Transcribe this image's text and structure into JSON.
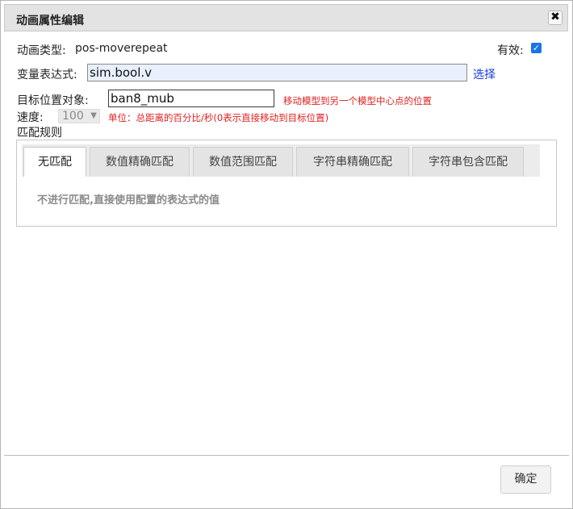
{
  "dialog": {
    "title": "动画属性编辑",
    "close_glyph": "✖"
  },
  "form": {
    "anim_type_label": "动画类型:",
    "anim_type_value": "pos-moverepeat",
    "valid_label": "有效:",
    "valid_checked": true,
    "expr_label": "变量表达式:",
    "expr_value": "sim.bool.v",
    "select_link": "选择",
    "target_label": "目标位置对象:",
    "target_value": "ban8_mub",
    "target_hint": "移动模型到另一个模型中心点的位置",
    "speed_label": "速度:",
    "speed_value": "100",
    "speed_hint": "单位：总距离的百分比/秒(0表示直接移动到目标位置)",
    "rules_label": "匹配规则"
  },
  "tabs": [
    {
      "label": "无匹配",
      "active": true
    },
    {
      "label": "数值精确匹配",
      "active": false
    },
    {
      "label": "数值范围匹配",
      "active": false
    },
    {
      "label": "字符串精确匹配",
      "active": false
    },
    {
      "label": "字符串包含匹配",
      "active": false
    }
  ],
  "rule_description": "不进行匹配,直接使用配置的表达式的值",
  "footer": {
    "confirm_label": "确定"
  },
  "colors": {
    "accent": "#1a73e8",
    "hint": "#e02020",
    "link": "#1a3cd8"
  },
  "icons": {
    "close": "close-icon",
    "check": "checkmark-icon",
    "dropdown": "chevron-down-icon"
  }
}
